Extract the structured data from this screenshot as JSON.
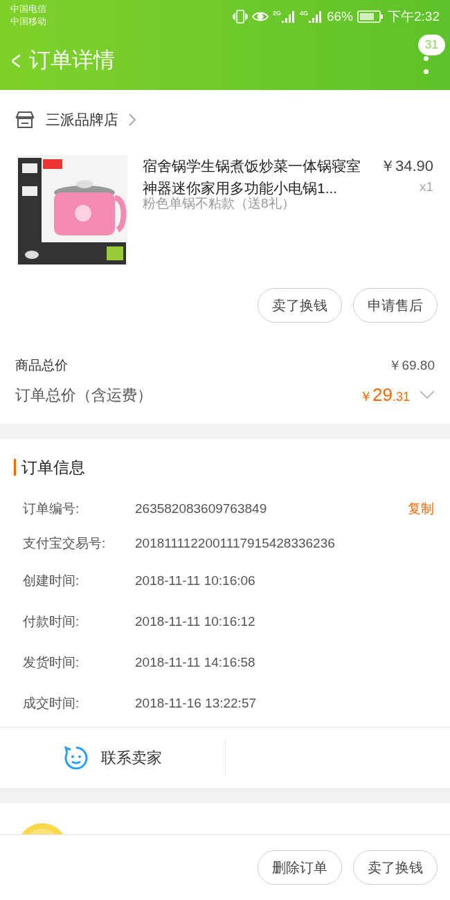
{
  "status_bar": {
    "carriers": [
      "中国电信",
      "中国移动"
    ],
    "net1": "2G",
    "net2": "4G",
    "battery": "66%",
    "time": "下午2:32"
  },
  "header": {
    "back": "<",
    "title": "订单详情",
    "badge": "31"
  },
  "shop": {
    "name": "三派品牌店"
  },
  "product": {
    "title": "宿舍锅学生锅煮饭炒菜一体锅寝室神器迷你家用多功能小电锅1...",
    "price": "￥34.90",
    "quantity": "x1",
    "sku": "粉色单锅不粘款（送8礼）"
  },
  "item_buttons": [
    "卖了换钱",
    "申请售后"
  ],
  "totals": {
    "goods_label": "商品总价",
    "goods_value": "￥69.80",
    "order_label": "订单总价（含运费）",
    "order_currency": "￥",
    "order_int": "29",
    "order_dec": ".31"
  },
  "order_info": {
    "title": "订单信息",
    "rows": [
      {
        "label": "订单编号:",
        "value": "263582083609763849",
        "action": "复制"
      },
      {
        "label": "支付宝交易号:",
        "value": "2018111122001117915428336236"
      },
      {
        "label": "创建时间:",
        "value": "2018-11-11 10:16:06"
      },
      {
        "label": "付款时间:",
        "value": "2018-11-11 10:16:12"
      },
      {
        "label": "发货时间:",
        "value": "2018-11-11 14:16:58"
      },
      {
        "label": "成交时间:",
        "value": "2018-11-16 13:22:57"
      }
    ]
  },
  "contact": {
    "label": "联系卖家"
  },
  "bottom_buttons": [
    "删除订单",
    "卖了换钱"
  ]
}
